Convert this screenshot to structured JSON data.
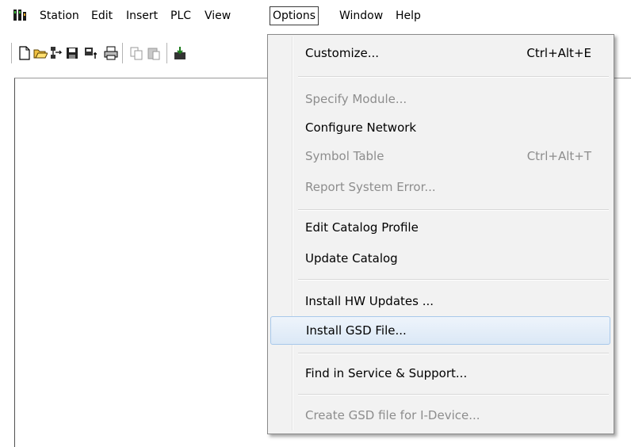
{
  "menubar": {
    "items": [
      {
        "label": "Station"
      },
      {
        "label": "Edit"
      },
      {
        "label": "Insert"
      },
      {
        "label": "PLC"
      },
      {
        "label": "View"
      },
      {
        "label": "Options"
      },
      {
        "label": "Window"
      },
      {
        "label": "Help"
      }
    ],
    "active": "Options"
  },
  "toolbar": {
    "buttons": [
      "new-icon",
      "open-icon",
      "network-icon",
      "save-icon",
      "compile-icon",
      "print-icon",
      "copy-icon",
      "paste-icon",
      "download-icon"
    ]
  },
  "options_menu": {
    "items": [
      {
        "label": "Customize...",
        "shortcut": "Ctrl+Alt+E",
        "enabled": true
      },
      {
        "label": "Specify Module...",
        "shortcut": "",
        "enabled": false
      },
      {
        "label": "Configure Network",
        "shortcut": "",
        "enabled": true
      },
      {
        "label": "Symbol Table",
        "shortcut": "Ctrl+Alt+T",
        "enabled": false
      },
      {
        "label": "Report System Error...",
        "shortcut": "",
        "enabled": false
      },
      {
        "label": "Edit Catalog Profile",
        "shortcut": "",
        "enabled": true
      },
      {
        "label": "Update Catalog",
        "shortcut": "",
        "enabled": true
      },
      {
        "label": "Install HW Updates ...",
        "shortcut": "",
        "enabled": true
      },
      {
        "label": "Install GSD File...",
        "shortcut": "",
        "enabled": true,
        "highlighted": true
      },
      {
        "label": "Find in Service & Support...",
        "shortcut": "",
        "enabled": true
      },
      {
        "label": "Create GSD file for I-Device...",
        "shortcut": "",
        "enabled": false
      }
    ]
  },
  "colors": {
    "menu_bg": "#f2f2f2",
    "disabled_text": "#8d8d8d",
    "highlight_border": "#a8c8ea"
  }
}
